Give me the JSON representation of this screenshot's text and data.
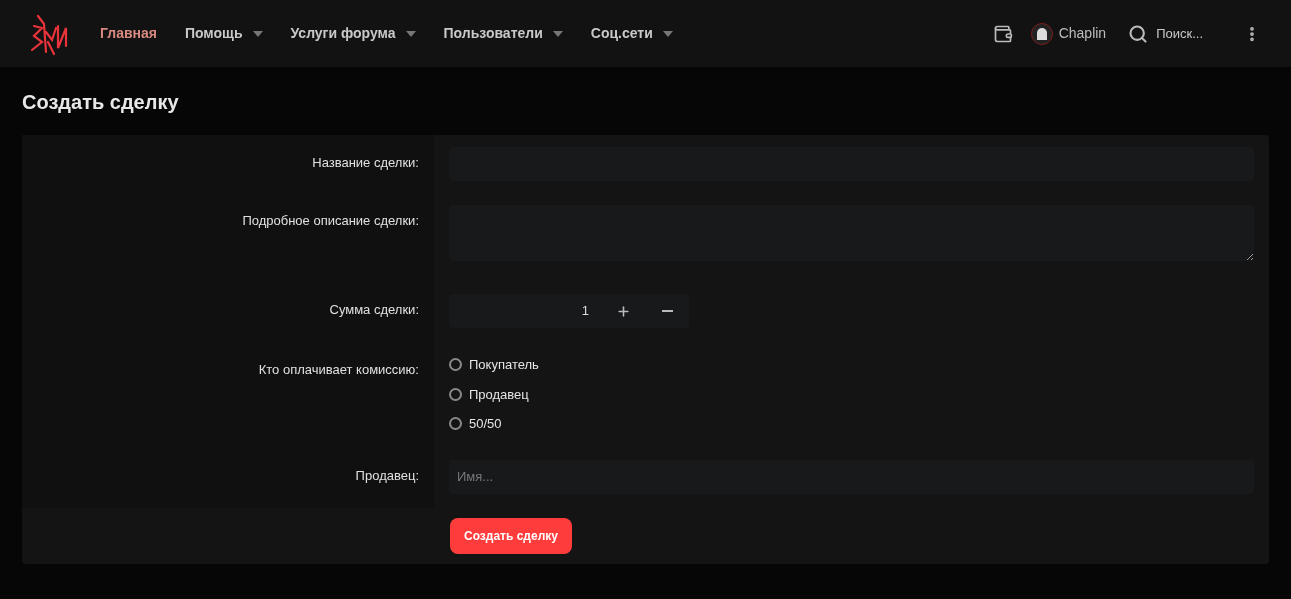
{
  "nav": {
    "items": [
      {
        "label": "Главная",
        "selected": true,
        "dropdown": false
      },
      {
        "label": "Помощь",
        "selected": false,
        "dropdown": true
      },
      {
        "label": "Услуги форума",
        "selected": false,
        "dropdown": true
      },
      {
        "label": "Пользователи",
        "selected": false,
        "dropdown": true
      },
      {
        "label": "Соц.сети",
        "selected": false,
        "dropdown": true
      }
    ],
    "user": "Chaplin",
    "search": "Поиск..."
  },
  "page_title": "Создать сделку",
  "form": {
    "rows": [
      {
        "kind": "text",
        "label": "Название сделки:"
      },
      {
        "kind": "textarea",
        "label": "Подробное описание сделки:"
      },
      {
        "kind": "number",
        "label": "Сумма сделки:",
        "value": "1"
      },
      {
        "kind": "radio",
        "label": "Кто оплачивает комиссию:",
        "options": [
          {
            "label": "Покупатель",
            "selected": false
          },
          {
            "label": "Продавец",
            "selected": false
          },
          {
            "label": "50/50",
            "selected": false
          }
        ]
      },
      {
        "kind": "text",
        "label": "Продавец:",
        "placeholder": "Имя..."
      }
    ],
    "submit": "Создать сделку"
  }
}
